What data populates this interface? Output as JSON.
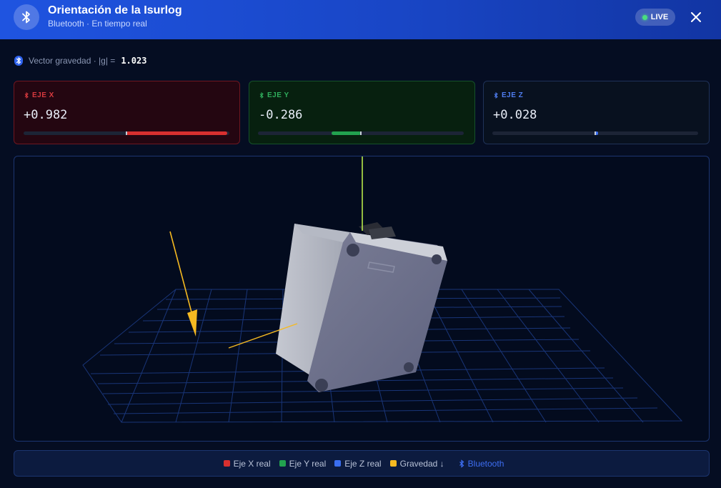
{
  "header": {
    "title": "Orientación de la Isurlog",
    "subtitle": "Bluetooth · En tiempo real",
    "live_label": "LIVE"
  },
  "gravity": {
    "label": "Vector gravedad · |g| =",
    "value": "1.023"
  },
  "axes": [
    {
      "label": "EJE X",
      "value": "+0.982",
      "reading": 0.982,
      "color": "#d8302f"
    },
    {
      "label": "EJE Y",
      "value": "-0.286",
      "reading": -0.286,
      "color": "#22a24f"
    },
    {
      "label": "EJE Z",
      "value": "+0.028",
      "reading": 0.028,
      "color": "#3a6ef0"
    }
  ],
  "legend": {
    "x_label": "Eje X real",
    "y_label": "Eje Y real",
    "z_label": "Eje Z real",
    "gravity_label": "Gravedad ↓",
    "bluetooth_label": "Bluetooth"
  },
  "colors": {
    "x": "#d8302f",
    "y": "#22a24f",
    "z": "#3a6ef0",
    "gravity": "#f5b921",
    "accent": "#1f54e0"
  },
  "icons": {
    "header": "bluetooth-icon",
    "close": "close-icon",
    "card": "bluetooth-icon"
  }
}
